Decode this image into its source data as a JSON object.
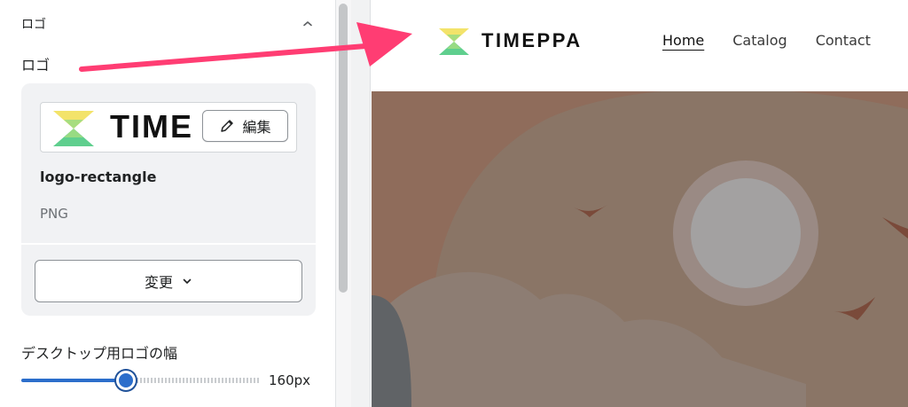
{
  "panel": {
    "section_title": "ロゴ",
    "field_label": "ロゴ",
    "logo_card": {
      "preview_text": "TIME",
      "edit_label": "編集",
      "file_name": "logo-rectangle",
      "file_type": "PNG",
      "change_label": "変更"
    },
    "width_setting": {
      "label": "デスクトップ用ロゴの幅",
      "value": "160px",
      "fraction": 0.44
    }
  },
  "preview": {
    "brand": "TIMEPPA",
    "nav": [
      {
        "label": "Home",
        "active": true
      },
      {
        "label": "Catalog",
        "active": false
      },
      {
        "label": "Contact",
        "active": false
      }
    ]
  },
  "colors": {
    "accent": "#2c6ecb",
    "arrow": "#ff3d73",
    "logo_yellow": "#f3e36a",
    "logo_green": "#5fcf8e"
  },
  "icons": [
    "chevron-up-icon",
    "pencil-icon",
    "chevron-down-icon",
    "hourglass-logo-icon",
    "annotation-arrow"
  ]
}
